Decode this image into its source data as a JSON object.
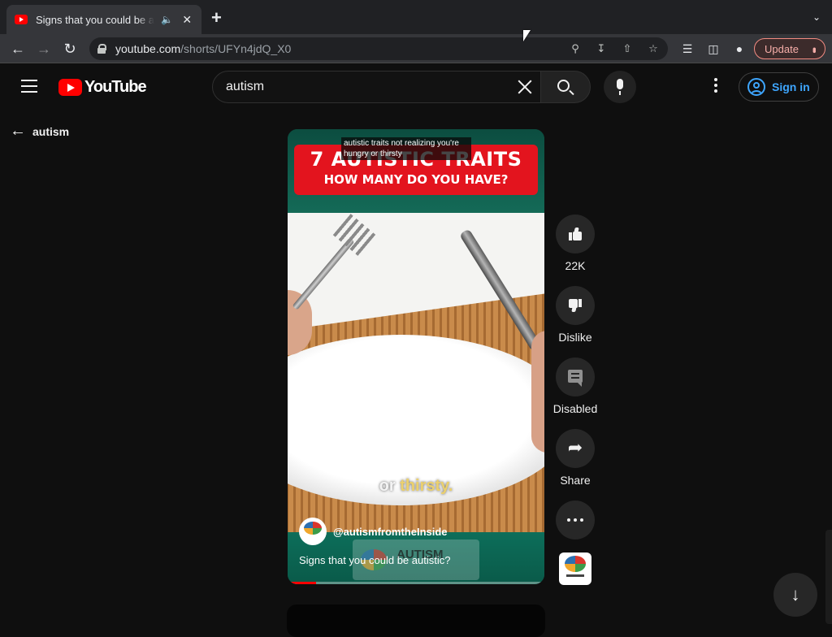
{
  "browser": {
    "tab_title": "Signs that you could be autistic?",
    "tab_audio_icon": "speaker-icon",
    "new_tab_label": "+",
    "url_host": "youtube.com",
    "url_path": "/shorts/UFYn4jdQ_X0",
    "update_label": "Update"
  },
  "masthead": {
    "logo_text": "YouTube",
    "search_value": "autism",
    "signin_label": "Sign in"
  },
  "back": {
    "label": "autism"
  },
  "short": {
    "caption_top": "autistic traits not realizing you're hungry or thirsty",
    "banner_line1": "7 AUTISTIC TRAITS",
    "banner_line2": "HOW MANY DO YOU HAVE?",
    "video_caption_plain": "or",
    "video_caption_highlight": "thirsty.",
    "watermark_text": "AUTISM",
    "channel": "@autismfromtheInside",
    "title": "Signs that you could be autistic?",
    "progress_fraction": 0.11
  },
  "actions": {
    "like_count": "22K",
    "dislike_label": "Dislike",
    "comments_label": "Disabled",
    "share_label": "Share"
  },
  "colors": {
    "accent": "#ff0000",
    "link": "#3ea6ff",
    "background": "#0f0f0f"
  }
}
